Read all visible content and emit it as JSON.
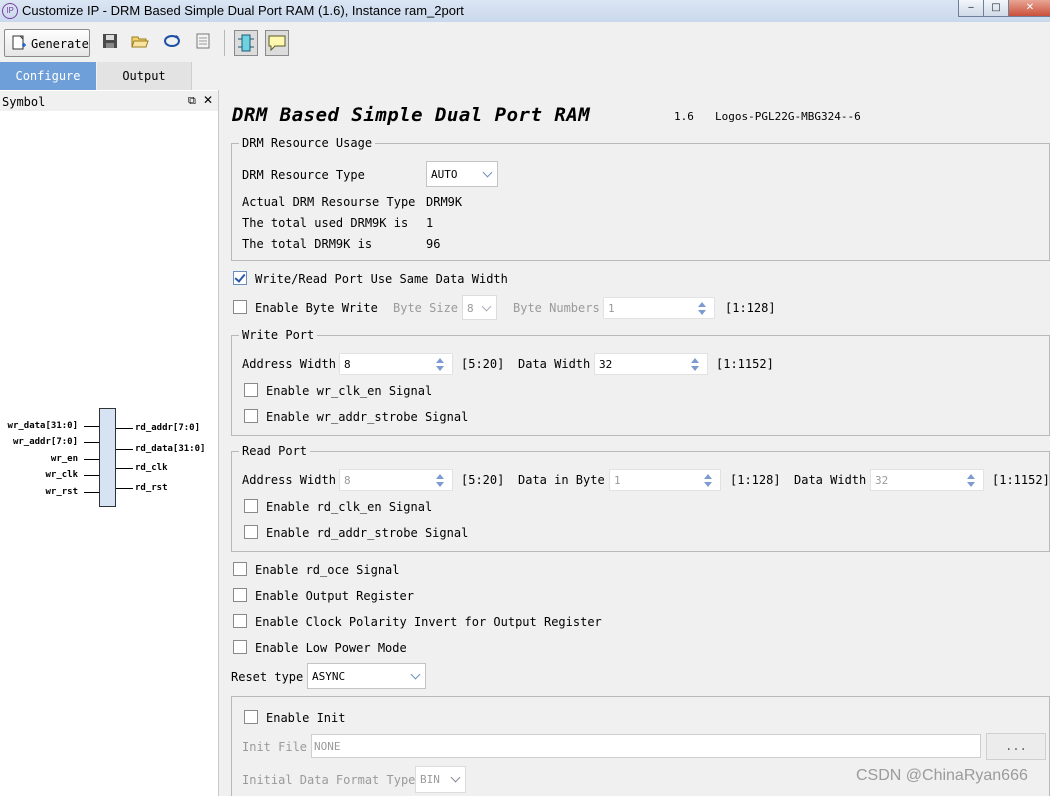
{
  "window": {
    "title": "Customize IP - DRM Based Simple Dual Port RAM (1.6), Instance ram_2port",
    "app_icon": "IP",
    "minimize": "‒",
    "maximize": "□",
    "close": "✕"
  },
  "toolbar": {
    "generate_label": "Generate",
    "icons": [
      "generate-icon",
      "save-icon",
      "open-folder-icon",
      "refresh-icon",
      "document-icon",
      "symbol-toggle-icon",
      "speech-bubble-icon"
    ]
  },
  "tabs": [
    {
      "label": "Configure",
      "active": true
    },
    {
      "label": "Output",
      "active": false
    }
  ],
  "symbol_panel": {
    "title": "Symbol",
    "inputs": [
      "wr_data[31:0]",
      "wr_addr[7:0]",
      "wr_en",
      "wr_clk",
      "wr_rst"
    ],
    "outputs": [
      "rd_addr[7:0]",
      "rd_data[31:0]",
      "rd_clk",
      "rd_rst"
    ]
  },
  "header": {
    "ip_name": "DRM Based Simple Dual Port RAM",
    "version": "1.6",
    "device": "Logos-PGL22G-MBG324--6"
  },
  "drm_usage": {
    "title": "DRM Resource Usage",
    "type_label": "DRM Resource Type",
    "type_value": "AUTO",
    "actual_label": "Actual DRM Resourse Type",
    "actual_value": "DRM9K",
    "used_label": "The total used DRM9K is",
    "used_value": "1",
    "total_label": "The total DRM9K is",
    "total_value": "96"
  },
  "same_width": {
    "label": "Write/Read Port Use Same Data Width",
    "checked": true
  },
  "byte_write": {
    "label": "Enable Byte Write",
    "byte_size_label": "Byte Size",
    "byte_size_value": "8",
    "byte_numbers_label": "Byte Numbers",
    "byte_numbers_value": "1",
    "range": "[1:128]"
  },
  "write_port": {
    "title": "Write Port",
    "addr_label": "Address Width",
    "addr_value": "8",
    "addr_range": "[5:20]",
    "data_label": "Data Width",
    "data_value": "32",
    "data_range": "[1:1152]",
    "clk_en_label": "Enable wr_clk_en Signal",
    "addr_strobe_label": "Enable wr_addr_strobe Signal"
  },
  "read_port": {
    "title": "Read Port",
    "addr_label": "Address Width",
    "addr_value": "8",
    "addr_range": "[5:20]",
    "byte_label": "Data in Byte",
    "byte_value": "1",
    "byte_range": "[1:128]",
    "data_label": "Data Width",
    "data_value": "32",
    "data_range": "[1:1152]",
    "clk_en_label": "Enable rd_clk_en Signal",
    "addr_strobe_label": "Enable rd_addr_strobe Signal"
  },
  "options": [
    {
      "label": "Enable rd_oce Signal"
    },
    {
      "label": "Enable Output Register"
    },
    {
      "label": "Enable Clock Polarity Invert for Output Register"
    },
    {
      "label": "Enable Low Power Mode"
    }
  ],
  "reset": {
    "label": "Reset type",
    "value": "ASYNC"
  },
  "init": {
    "enable_label": "Enable Init",
    "file_label": "Init File",
    "file_value": "NONE",
    "browse_label": "...",
    "format_label": "Initial Data Format Type",
    "format_value": "BIN"
  },
  "watermark": "CSDN @ChinaRyan666",
  "colors": {
    "active_tab": "#6f9fd8",
    "spin_arrow": "#7d9bd1",
    "symbol_fill": "#d6e3f2"
  }
}
